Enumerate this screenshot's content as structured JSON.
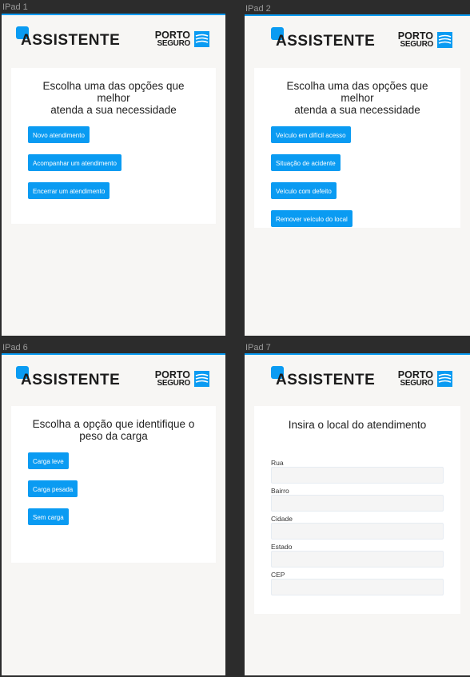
{
  "brand": {
    "app_name": "ASSISTENTE",
    "company_line1": "PORTO",
    "company_line2": "SEGURO"
  },
  "frames": [
    {
      "label": "IPad 1",
      "title_line1": "Escolha uma das opções que melhor",
      "title_line2": "atenda a sua necessidade",
      "buttons": [
        "Novo atendimento",
        "Acompanhar um atendimento",
        "Encerrar um atendimento"
      ]
    },
    {
      "label": "IPad 2",
      "title_line1": "Escolha uma das opções que melhor",
      "title_line2": "atenda a sua necessidade",
      "buttons": [
        "Veículo em difícil acesso",
        "Situação de acidente",
        "Veículo com defeito",
        "Remover veículo do local"
      ]
    },
    {
      "label": "IPad 6",
      "title_line1": "Escolha a opção que identifique o",
      "title_line2": "peso da carga",
      "buttons": [
        "Carga leve",
        "Carga pesada",
        "Sem carga"
      ]
    },
    {
      "label": "IPad 7",
      "title_line1": "Insira o local do atendimento",
      "fields": [
        {
          "label": "Rua",
          "value": ""
        },
        {
          "label": "Bairro",
          "value": ""
        },
        {
          "label": "Cidade",
          "value": ""
        },
        {
          "label": "Estado",
          "value": ""
        },
        {
          "label": "CEP",
          "value": ""
        }
      ]
    }
  ],
  "colors": {
    "accent": "#0a9bf2",
    "canvas": "#2c2c2c",
    "screen_bg": "#f7f6f4",
    "card_bg": "#ffffff"
  }
}
